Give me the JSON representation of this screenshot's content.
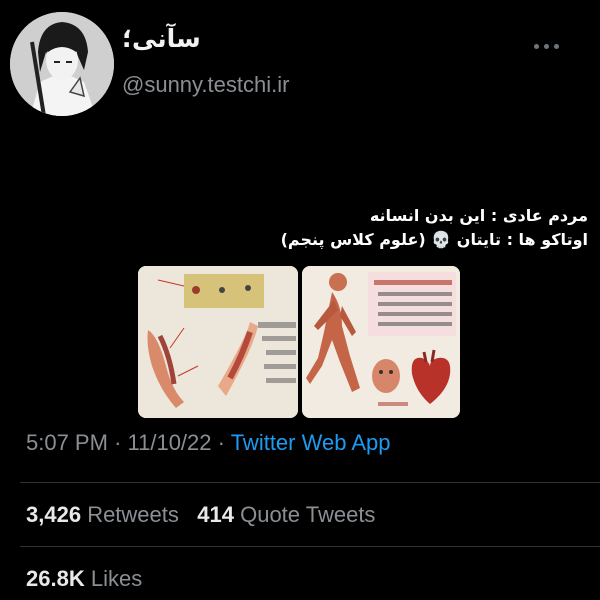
{
  "profile": {
    "display_name": "سآنی؛",
    "handle": "@sunny.testchi.ir"
  },
  "tweet": {
    "lines": [
      "مردم عادی : این بدن انسانه",
      "اوتاکو ها : تایتان 💀 (علوم کلاس پنجم)"
    ]
  },
  "meta": {
    "time": "5:07 PM",
    "sep1": "·",
    "date": "11/10/22",
    "sep2": "·",
    "source": "Twitter Web App"
  },
  "stats": {
    "retweets_count": "3,426",
    "retweets_label": "Retweets",
    "quotes_count": "414",
    "quotes_label": "Quote Tweets",
    "likes_count": "26.8K",
    "likes_label": "Likes"
  },
  "colors": {
    "background": "#000000",
    "link": "#1d9bf0",
    "secondary_text": "#8b8f94"
  }
}
